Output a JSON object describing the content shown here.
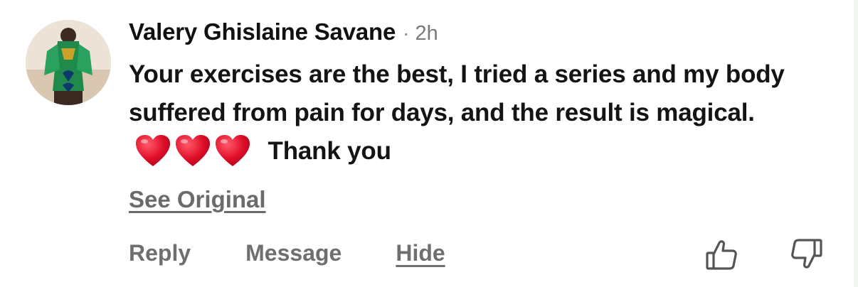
{
  "comment": {
    "author": "Valery Ghislaine Savane",
    "separator": "·",
    "timestamp": "2h",
    "text_before_emoji": "Your exercises are the best, I tried a series and my body suffered from pain for days, and the result is magical.",
    "emoji": [
      "red-heart",
      "red-heart",
      "red-heart"
    ],
    "text_after_emoji": "Thank you",
    "see_original_label": "See Original"
  },
  "actions": {
    "reply_label": "Reply",
    "message_label": "Message",
    "hide_label": "Hide",
    "upvote_icon": "thumbs-up-icon",
    "downvote_icon": "thumbs-down-icon"
  },
  "colors": {
    "author": "#111111",
    "meta": "#7a7a7a",
    "action": "#6f6f6f",
    "heart": "#e0102a"
  }
}
